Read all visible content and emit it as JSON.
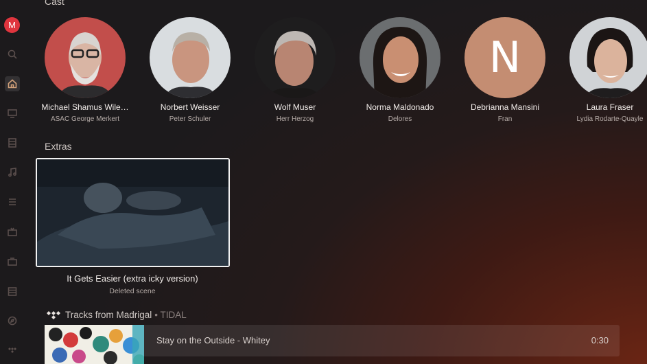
{
  "user": {
    "initial": "M"
  },
  "sidebar": {
    "items": [
      {
        "icon": "search-icon"
      },
      {
        "icon": "home-icon",
        "active": true
      },
      {
        "icon": "monitor-icon"
      },
      {
        "icon": "film-icon"
      },
      {
        "icon": "music-icon"
      },
      {
        "icon": "list-icon"
      },
      {
        "icon": "tv-icon"
      },
      {
        "icon": "live-tv-icon"
      },
      {
        "icon": "calendar-icon"
      },
      {
        "icon": "compass-icon"
      },
      {
        "icon": "tidal-icon"
      }
    ]
  },
  "cast": {
    "title": "Cast",
    "members": [
      {
        "name": "Michael Shamus Wile…",
        "role": "ASAC George Merkert",
        "bg": "#c24e4b"
      },
      {
        "name": "Norbert Weisser",
        "role": "Peter Schuler",
        "bg": "#d9dde0"
      },
      {
        "name": "Wolf Muser",
        "role": "Herr Herzog",
        "bg": "#1e1d1e"
      },
      {
        "name": "Norma Maldonado",
        "role": "Delores",
        "bg": "#6b6e70"
      },
      {
        "name": "Debrianna Mansini",
        "role": "Fran",
        "bg": "#c48d72",
        "initial": "N"
      },
      {
        "name": "Laura Fraser",
        "role": "Lydia Rodarte-Quayle",
        "bg": "#d0d3d6"
      }
    ]
  },
  "extras": {
    "title": "Extras",
    "item": {
      "title": "It Gets Easier (extra icky version)",
      "subtitle": "Deleted scene"
    }
  },
  "tracks": {
    "title": "Tracks from Madrigal",
    "source": "• TIDAL",
    "items": [
      {
        "title": "Stay on the Outside - Whitey",
        "duration": "0:30"
      }
    ]
  },
  "colors": {
    "accent": "#d4a27a",
    "avatar": "#e0353e"
  }
}
